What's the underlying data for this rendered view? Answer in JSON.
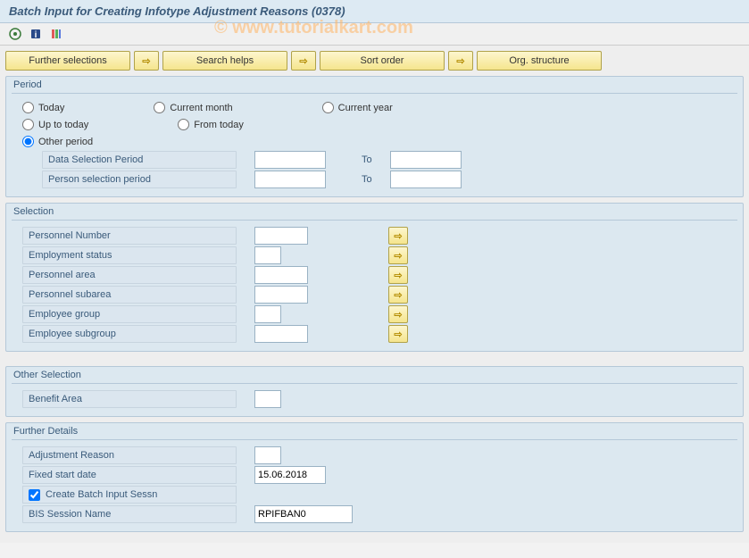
{
  "header": {
    "title": "Batch Input for Creating Infotype Adjustment Reasons (0378)"
  },
  "watermark": "© www.tutorialkart.com",
  "toolbarButtons": {
    "furtherSelections": "Further selections",
    "searchHelps": "Search helps",
    "sortOrder": "Sort order",
    "orgStructure": "Org. structure"
  },
  "groups": {
    "period": {
      "title": "Period",
      "radios": {
        "today": "Today",
        "currentMonth": "Current month",
        "currentYear": "Current year",
        "upToToday": "Up to today",
        "fromToday": "From today",
        "otherPeriod": "Other period"
      },
      "dataSelectionPeriod": "Data Selection Period",
      "personSelectionPeriod": "Person selection period",
      "to": "To",
      "selected": "otherPeriod"
    },
    "selection": {
      "title": "Selection",
      "personnelNumber": "Personnel Number",
      "employmentStatus": "Employment status",
      "personnelArea": "Personnel area",
      "personnelSubarea": "Personnel subarea",
      "employeeGroup": "Employee group",
      "employeeSubgroup": "Employee subgroup"
    },
    "otherSelection": {
      "title": "Other Selection",
      "benefitArea": "Benefit Area"
    },
    "furtherDetails": {
      "title": "Further Details",
      "adjustmentReason": "Adjustment Reason",
      "fixedStartDate": {
        "label": "Fixed start date",
        "value": "15.06.2018"
      },
      "createBatchInputSessn": {
        "label": "Create Batch Input Sessn",
        "checked": true
      },
      "bisSessionName": {
        "label": "BIS Session Name",
        "value": "RPIFBAN0"
      }
    }
  }
}
